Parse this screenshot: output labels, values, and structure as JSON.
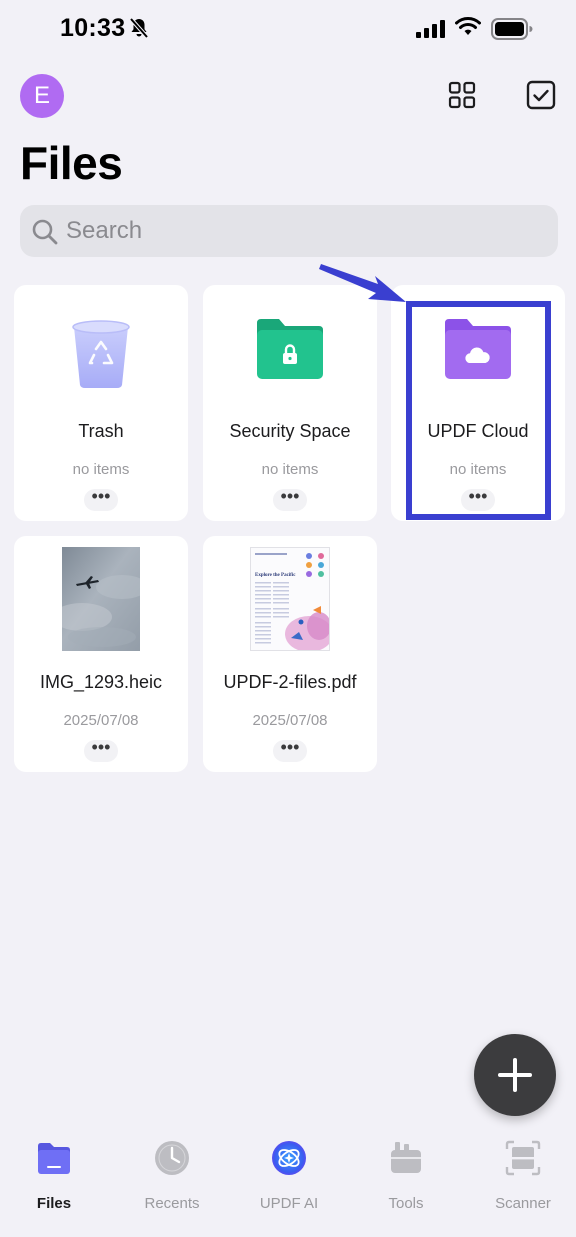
{
  "status": {
    "time": "10:33"
  },
  "header": {
    "avatar_letter": "E",
    "title": "Files"
  },
  "search": {
    "placeholder": "Search",
    "value": ""
  },
  "items": [
    {
      "name": "Trash",
      "sub": "no items",
      "more": "•••"
    },
    {
      "name": "Security Space",
      "sub": "no items",
      "more": "•••"
    },
    {
      "name": "UPDF Cloud",
      "sub": "no items",
      "more": "•••"
    },
    {
      "name": "IMG_1293.heic",
      "sub": "2025/07/08",
      "more": "•••"
    },
    {
      "name": "UPDF-2-files.pdf",
      "sub": "2025/07/08",
      "more": "•••",
      "thumb_heading": "Explore the Pacific"
    }
  ],
  "tabs": [
    {
      "label": "Files",
      "active": true
    },
    {
      "label": "Recents",
      "active": false
    },
    {
      "label": "UPDF AI",
      "active": false
    },
    {
      "label": "Tools",
      "active": false
    },
    {
      "label": "Scanner",
      "active": false
    }
  ],
  "colors": {
    "background": "#f2f1f7",
    "avatar": "#b06bf2",
    "security_folder": "#22c38e",
    "cloud_folder": "#a26bf0",
    "highlight": "#3a3fd0",
    "files_tab": "#6f6ff5"
  }
}
